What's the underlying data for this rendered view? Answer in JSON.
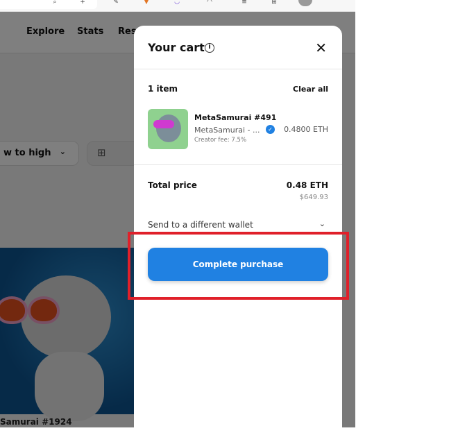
{
  "browser": {
    "icons": [
      "back-icon",
      "zoom-icon",
      "search-icon",
      "add-tab-icon",
      "extension-icon",
      "metamask-icon",
      "circle-extension-icon",
      "puzzle-icon",
      "favorites-icon",
      "collections-icon",
      "profile-avatar"
    ]
  },
  "nav": {
    "links": [
      "Explore",
      "Stats",
      "Res"
    ]
  },
  "sort": {
    "value": "w to high"
  },
  "nft_card": {
    "title": "Samurai #1924"
  },
  "cart": {
    "title": "Your cart",
    "item_count": "1 item",
    "clear_all": "Clear all",
    "item": {
      "name": "MetaSamurai #491",
      "collection": "MetaSamurai - ...",
      "creator_fee": "Creator fee: 7.5%",
      "price": "0.4800 ETH"
    },
    "total_label": "Total price",
    "total_eth": "0.48 ETH",
    "total_usd": "$649.93",
    "wallet_option": "Send to a different wallet",
    "purchase_button": "Complete purchase"
  },
  "colors": {
    "accent": "#2081e2",
    "highlight": "#e0202a"
  }
}
